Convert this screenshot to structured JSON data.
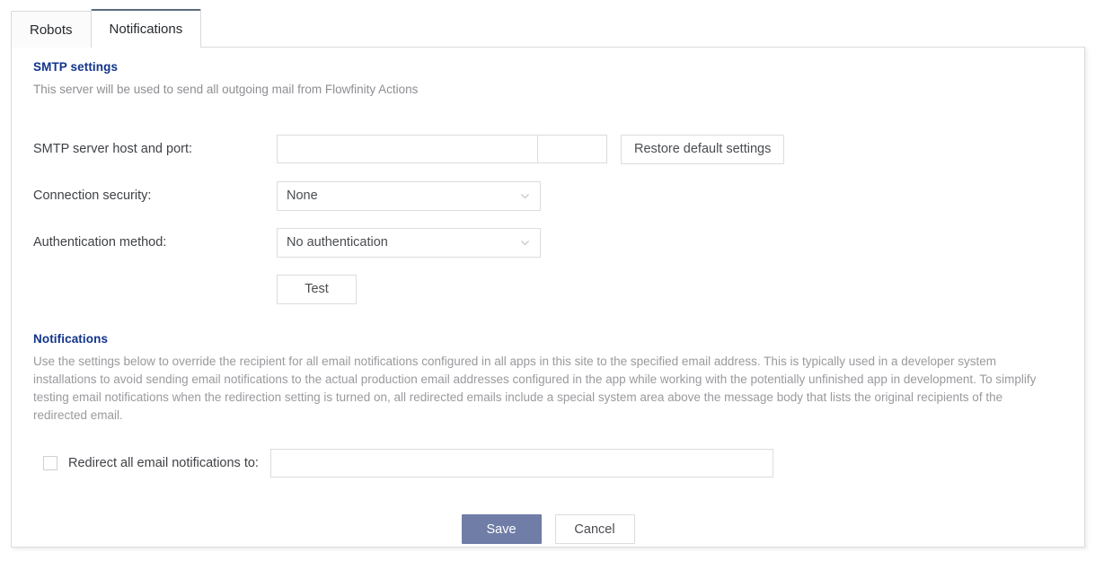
{
  "tabs": [
    {
      "label": "Robots",
      "active": false
    },
    {
      "label": "Notifications",
      "active": true
    }
  ],
  "smtp": {
    "title": "SMTP settings",
    "description": "This server will be used to send all outgoing mail from Flowfinity Actions",
    "host_label": "SMTP server host and port:",
    "host_value": "",
    "host_placeholder": "",
    "port_value": "",
    "port_placeholder": "",
    "restore_button": "Restore default settings",
    "connection_security_label": "Connection security:",
    "connection_security_value": "None",
    "auth_method_label": "Authentication method:",
    "auth_method_value": "No authentication",
    "test_button": "Test"
  },
  "notifications": {
    "title": "Notifications",
    "description": "Use the settings below to override the recipient for all email notifications configured in all apps in this site to the specified email address. This is typically used in a developer system installations to avoid sending email notifications to the actual production email addresses configured in the app while working with the potentially unfinished app in development. To simplify testing email notifications when the redirection setting is turned on, all redirected emails include a special system area above the message body that lists the original recipients of the redirected email.",
    "redirect_label": "Redirect all email notifications to:",
    "redirect_checked": false,
    "redirect_value": "",
    "redirect_placeholder": ""
  },
  "actions": {
    "save_label": "Save",
    "cancel_label": "Cancel"
  },
  "colors": {
    "heading": "#11348c",
    "save_bg": "#6f7da7",
    "active_tab_border": "#5a6b7d",
    "muted_text": "#9a9a9e"
  }
}
